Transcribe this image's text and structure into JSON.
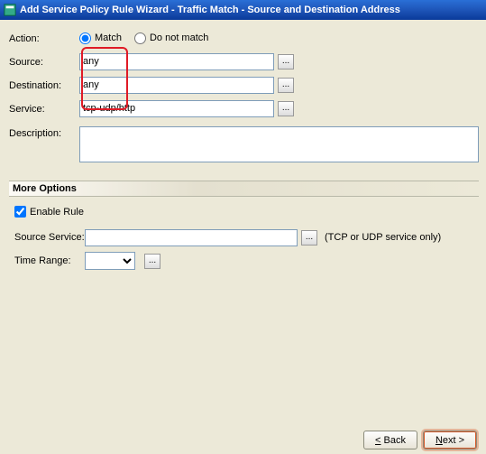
{
  "titlebar": {
    "title": "Add Service Policy Rule Wizard - Traffic Match - Source and Destination Address"
  },
  "form": {
    "action_label": "Action:",
    "match_label": "Match",
    "notmatch_label": "Do not match",
    "action_selected": "match",
    "source_label": "Source:",
    "source_value": "any",
    "destination_label": "Destination:",
    "destination_value": "any",
    "service_label": "Service:",
    "service_value": "tcp-udp/http",
    "description_label": "Description:",
    "description_value": "",
    "browse_btn": "..."
  },
  "more_options": {
    "header": "More Options",
    "enable_rule_label": "Enable Rule",
    "enable_rule_checked": true,
    "source_service_label": "Source Service:",
    "source_service_value": "",
    "source_service_hint": "(TCP or UDP service only)",
    "time_range_label": "Time Range:",
    "time_range_value": "",
    "browse_btn": "..."
  },
  "buttons": {
    "back": "< Back",
    "next": "Next >"
  }
}
